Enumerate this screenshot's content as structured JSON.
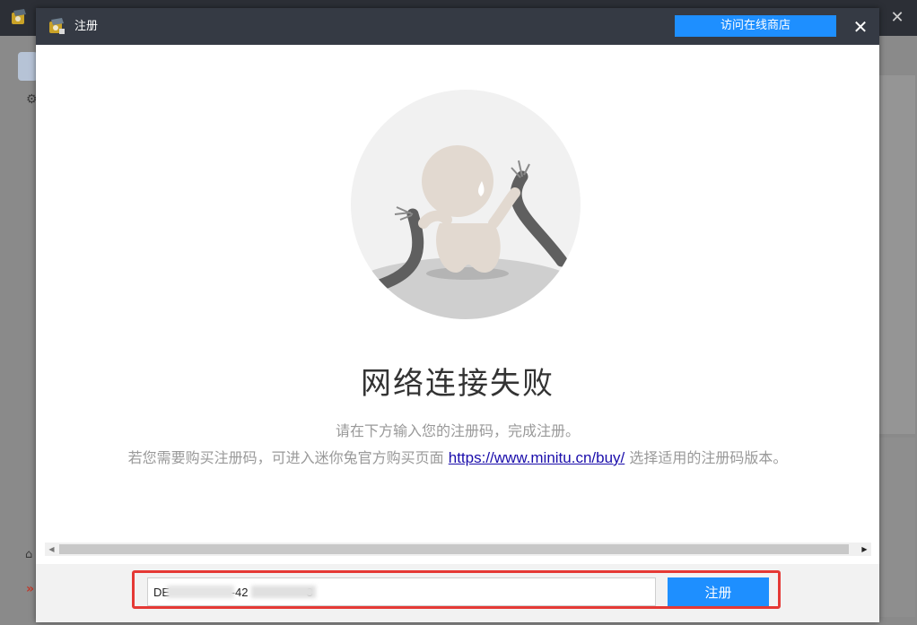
{
  "dialog": {
    "title": "注册",
    "store_button_label": "访问在线商店",
    "close_glyph": "✕"
  },
  "content": {
    "headline": "网络连接失败",
    "line1": "请在下方输入您的注册码，完成注册。",
    "line2_before": "若您需要购买注册码，可进入迷你兔官方购买页面 ",
    "link_text": "https://www.minitu.cn/buy/",
    "line2_after": " 选择适用的注册码版本。"
  },
  "footer": {
    "registration_code_value": "DE                   -42                  3",
    "register_button_label": "注册"
  },
  "background": {
    "close_glyph": "✕"
  },
  "colors": {
    "accent": "#1e8fff",
    "titlebar": "#353a44",
    "highlight": "#e53935",
    "link": "#1a0dab"
  },
  "icons": [
    "app-logo-icon",
    "close-icon",
    "disconnected-cable-illustration",
    "scroll-left-arrow-icon",
    "scroll-right-arrow-icon",
    "gear-icon",
    "home-icon"
  ]
}
